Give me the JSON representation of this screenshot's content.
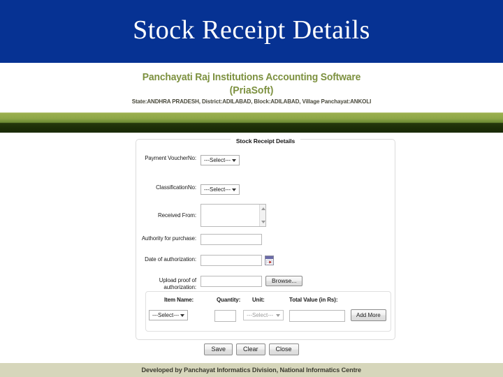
{
  "slide": {
    "title": "Stock Receipt Details",
    "banner_color": "#063293"
  },
  "app_header": {
    "title": "Panchayati Raj Institutions Accounting Software",
    "subtitle": "(PriaSoft)",
    "location": "State:ANDHRA PRADESH,  District:ADILABAD,  Block:ADILABAD,  Village Panchayat:ANKOLI",
    "brand_color": "#7d9140",
    "bar_color_top": "#9cb050",
    "bar_color_bottom": "#1a2b06"
  },
  "form": {
    "legend": "Stock Receipt Details",
    "fields": {
      "payment_voucher_no": {
        "label": "Payment VoucherNo:",
        "value": "---Select---"
      },
      "classification_no": {
        "label": "ClassificationNo:",
        "value": "---Select---"
      },
      "received_from": {
        "label": "Received From:",
        "value": ""
      },
      "authority_for_purchase": {
        "label": "Authority for purchase:",
        "value": ""
      },
      "date_of_authorization": {
        "label": "Date of authorization:",
        "value": "",
        "icon": "calendar-icon"
      },
      "upload_proof": {
        "label": "Upload proof of authorization:",
        "value": "",
        "browse_label": "Browse..."
      }
    },
    "item_table": {
      "headers": [
        "Item Name:",
        "Quantity:",
        "Unit:",
        "Total Value (in Rs):"
      ],
      "row": {
        "item_name": "---Select---",
        "quantity": "",
        "unit": "---Select---",
        "unit_disabled": true,
        "total_value": ""
      },
      "add_more_label": "Add More"
    },
    "actions": [
      "Save",
      "Clear",
      "Close"
    ]
  },
  "footer": {
    "text": "Developed by Panchayat Informatics Division, National Informatics Centre",
    "band_color": "#d6d6bb"
  }
}
